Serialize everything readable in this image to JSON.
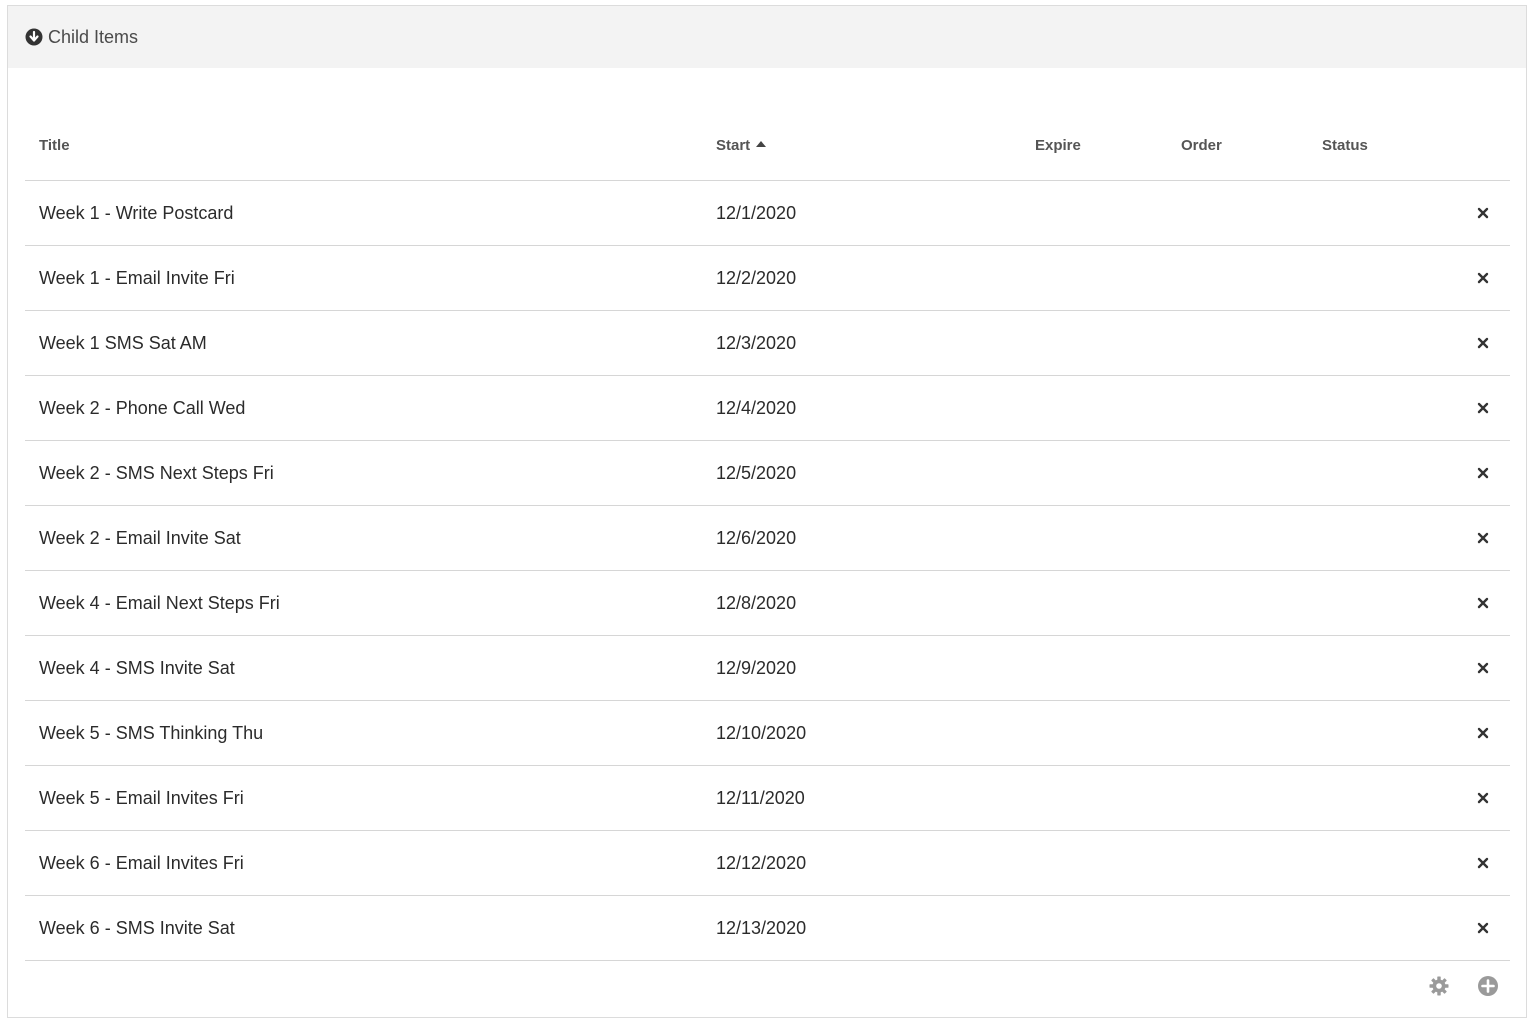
{
  "panel": {
    "title": "Child Items",
    "toggle_icon": "arrow-circle-down-icon"
  },
  "grid": {
    "columns": {
      "title": "Title",
      "start": "Start",
      "expire": "Expire",
      "order": "Order",
      "status": "Status"
    },
    "sort": {
      "column": "start",
      "direction": "ascending"
    },
    "rows": [
      {
        "title": "Week 1 - Write Postcard",
        "start": "12/1/2020",
        "expire": "",
        "order": "",
        "status": ""
      },
      {
        "title": "Week 1 - Email Invite Fri",
        "start": "12/2/2020",
        "expire": "",
        "order": "",
        "status": ""
      },
      {
        "title": "Week 1 SMS Sat AM",
        "start": "12/3/2020",
        "expire": "",
        "order": "",
        "status": ""
      },
      {
        "title": "Week 2 - Phone Call Wed",
        "start": "12/4/2020",
        "expire": "",
        "order": "",
        "status": ""
      },
      {
        "title": "Week 2 - SMS Next Steps Fri",
        "start": "12/5/2020",
        "expire": "",
        "order": "",
        "status": ""
      },
      {
        "title": "Week 2 - Email Invite Sat",
        "start": "12/6/2020",
        "expire": "",
        "order": "",
        "status": ""
      },
      {
        "title": "Week 4 - Email Next Steps Fri",
        "start": "12/8/2020",
        "expire": "",
        "order": "",
        "status": ""
      },
      {
        "title": "Week 4 - SMS Invite Sat",
        "start": "12/9/2020",
        "expire": "",
        "order": "",
        "status": ""
      },
      {
        "title": "Week 5 - SMS Thinking Thu",
        "start": "12/10/2020",
        "expire": "",
        "order": "",
        "status": ""
      },
      {
        "title": "Week 5 - Email Invites Fri",
        "start": "12/11/2020",
        "expire": "",
        "order": "",
        "status": ""
      },
      {
        "title": "Week 6 - Email Invites Fri",
        "start": "12/12/2020",
        "expire": "",
        "order": "",
        "status": ""
      },
      {
        "title": "Week 6 - SMS Invite Sat",
        "start": "12/13/2020",
        "expire": "",
        "order": "",
        "status": ""
      }
    ],
    "row_action_icon": "close-icon",
    "footer": {
      "settings_icon": "gear-icon",
      "add_icon": "plus-circle-icon"
    }
  },
  "colors": {
    "header_bg": "#f3f3f3",
    "border": "#d6d6d6",
    "footer_icon": "#9a9a9a",
    "delete_icon": "#333333"
  }
}
